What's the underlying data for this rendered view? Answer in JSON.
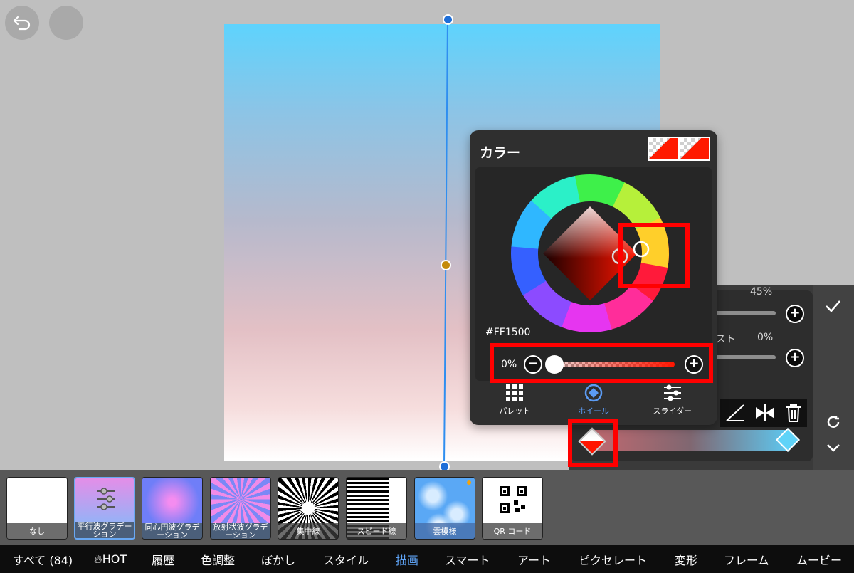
{
  "toolbar": {
    "undo": "undo-icon",
    "menu": "circle-icon"
  },
  "color_popup": {
    "title": "カラー",
    "hex": "#FF1500",
    "alpha_pct": "0%",
    "minus": "−",
    "plus": "+",
    "tabs": [
      {
        "label": "パレット",
        "icon": "grid-icon"
      },
      {
        "label": "ホイール",
        "icon": "wheel-icon"
      },
      {
        "label": "スライダー",
        "icon": "sliders-icon"
      }
    ]
  },
  "side_panel": {
    "value1": "45%",
    "value2": "0%",
    "contrast_label": "ラスト"
  },
  "filters": [
    {
      "label": "なし"
    },
    {
      "label": "平行波グラデーション"
    },
    {
      "label": "同心円波グラデーション"
    },
    {
      "label": "放射状波グラデーション"
    },
    {
      "label": "集中線"
    },
    {
      "label": "スピード線"
    },
    {
      "label": "雲模様"
    },
    {
      "label": "QR コード"
    }
  ],
  "categories": [
    "すべて (84)",
    "HOT",
    "履歴",
    "色調整",
    "ぼかし",
    "スタイル",
    "描画",
    "スマート",
    "アート",
    "ピクセレート",
    "変形",
    "フレーム",
    "ムービー"
  ],
  "colors": {
    "accent": "#5fa4f7",
    "selected_color": "#FF1500",
    "highlight": "#ff0000"
  }
}
